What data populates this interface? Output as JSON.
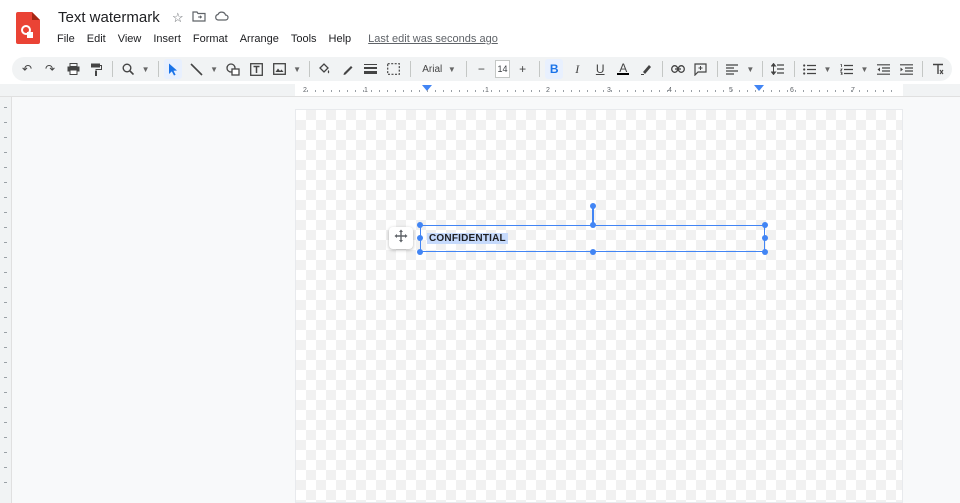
{
  "document": {
    "title": "Text watermark",
    "last_edit": "Last edit was seconds ago"
  },
  "title_icons": [
    "star-icon",
    "move-to-folder-icon",
    "cloud-saved-icon"
  ],
  "menu": [
    "File",
    "Edit",
    "View",
    "Insert",
    "Format",
    "Arrange",
    "Tools",
    "Help"
  ],
  "toolbar": {
    "font_family": "Arial",
    "font_size": "14",
    "decrease_size": "−",
    "increase_size": "+",
    "bold": "B",
    "italic": "I",
    "underline": "U",
    "text_color": "A",
    "bold_active": true
  },
  "ruler": {
    "labels": [
      "2",
      "1",
      "1",
      "2",
      "3",
      "4",
      "5",
      "6",
      "7"
    ]
  },
  "textbox": {
    "text": "CONFIDENTIAL"
  },
  "colors": {
    "accent": "#4285f4",
    "selection": "#c6dafc",
    "app_icon": "#ea4335"
  }
}
